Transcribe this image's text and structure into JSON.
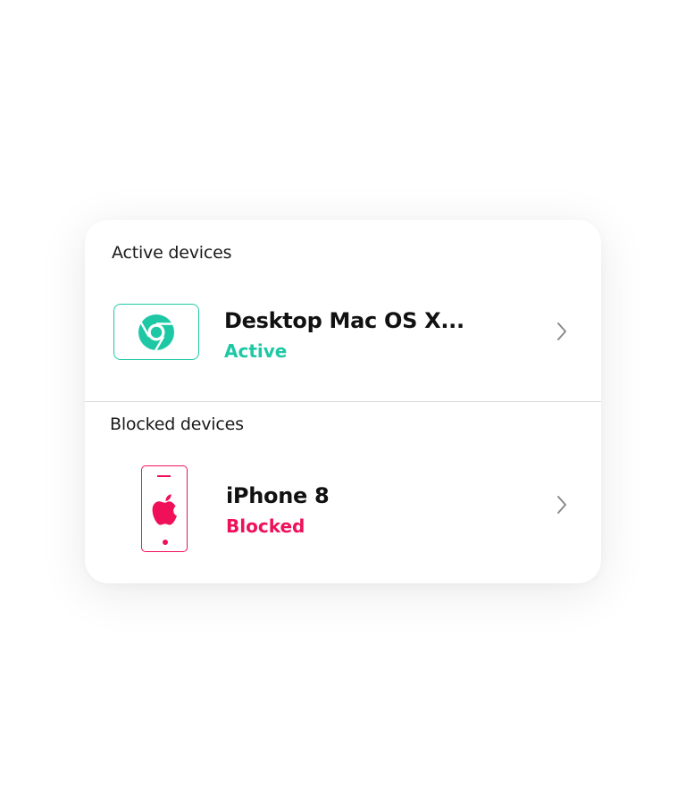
{
  "sections": {
    "active": {
      "label": "Active devices",
      "devices": [
        {
          "name": "Desktop Mac OS X...",
          "status": "Active",
          "icon": "chrome-icon",
          "status_color": "#1ec8a5"
        }
      ]
    },
    "blocked": {
      "label": "Blocked devices",
      "devices": [
        {
          "name": "iPhone 8",
          "status": "Blocked",
          "icon": "apple-icon",
          "status_color": "#f0105a"
        }
      ]
    }
  },
  "colors": {
    "active_accent": "#1ec8a5",
    "blocked_accent": "#f0105a",
    "text_primary": "#111111",
    "chevron": "#8a8a8a"
  }
}
